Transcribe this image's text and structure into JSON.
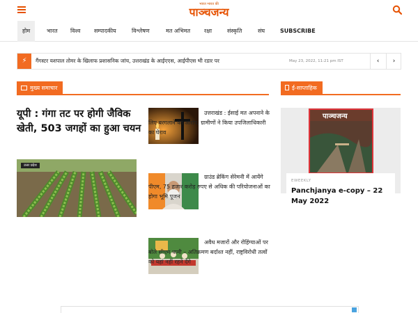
{
  "header": {
    "logo_tagline": "भारत भारत की",
    "logo_text": "पाञ्चजन्य"
  },
  "nav": {
    "items": [
      "होम",
      "भारत",
      "विश्व",
      "सम्पादकीय",
      "विश्लेषण",
      "मत अभिमत",
      "रक्षा",
      "संस्कृति",
      "संघ"
    ],
    "subscribe": "SUBSCRIBE"
  },
  "ticker": {
    "text": "गैंगस्टर यशपाल तोमर के खिलाफ प्रशासनिक जांच, उत्तराखंड के आईएएस, आईपीएस भी रडार पर",
    "date": "May 23, 2022, 11:21 pm IST",
    "prev": "‹",
    "next": "›"
  },
  "main": {
    "section_title": "मुख्य समाचार",
    "lead": {
      "title": "यूपी : गंगा तट पर होगी जैविक खेती, 503 जगहों का हुआ चयन",
      "badge": "उत्तर प्रदेश"
    },
    "stories": [
      {
        "text": "उत्तराखंड : ईसाई मत अपनाने के लिए बरगलाने का आरोप, ग्रामीणों ने किया उपजिलाधिकारी का घेराव"
      },
      {
        "text": "ग्राउंड ब्रेकिंग सेरेमनी में आयेंगे पीएम, 75 हजार करोड़ रुपए से अधिक की परियोजनाओं का होगा भूमि पूजन"
      },
      {
        "text": "अवैध मजारों और रोहिंग्याओं पर बोले सीएम धामी – अतिक्रमण बर्दाश्त नहीं, राष्ट्रविरोधी तत्वों को यहां नहीं रहने देंगे"
      }
    ]
  },
  "sidebar": {
    "section_title": "ई-साप्ताहिक",
    "cover_title": "पाञ्चजन्य",
    "tag": "EWEEKLY",
    "title": "Panchjanya e-copy – 22 May 2022"
  },
  "colors": {
    "accent": "#f26b21",
    "logo": "#e65100"
  }
}
